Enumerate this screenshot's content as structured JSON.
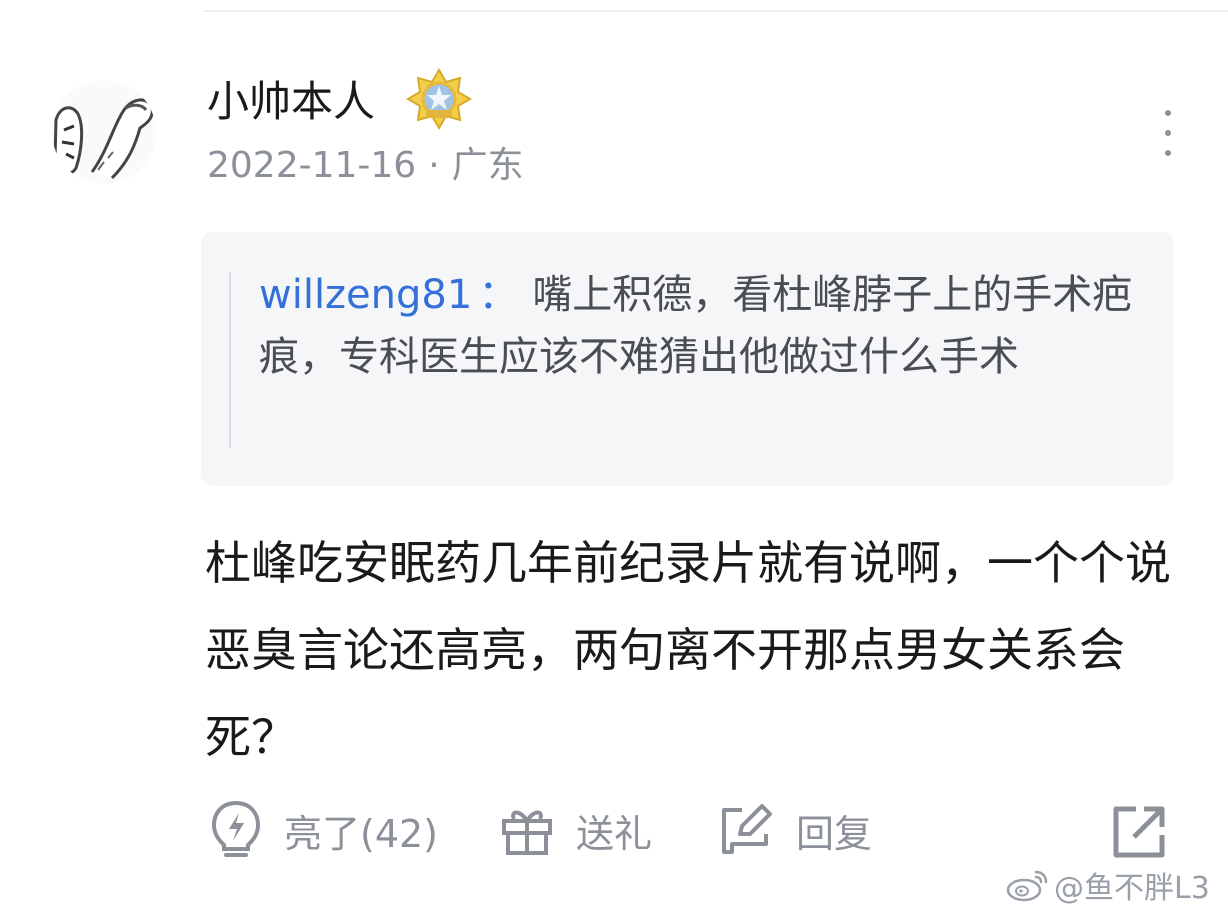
{
  "comment": {
    "username": "小帅本人",
    "date": "2022-11-16",
    "location": "广东",
    "meta_separator": "·",
    "quote": {
      "user": "willzeng81",
      "colon": "：",
      "text": "嘴上积德，看杜峰脖子上的手术疤痕，专科医生应该不难猜出他做过什么手术"
    },
    "body": "杜峰吃安眠药几年前纪录片就有说啊，一个个说恶臭言论还高亮，两句离不开那点男女关系会死？"
  },
  "actions": {
    "like_label": "亮了(42)",
    "gift_label": "送礼",
    "reply_label": "回复"
  },
  "watermark": {
    "text": "@鱼不胖L3"
  },
  "icons": {
    "avatar": "cartoon-avatar",
    "badge": "gold-medal-badge-icon",
    "more": "more-vertical-icon",
    "like": "lightbulb-icon",
    "gift": "gift-icon",
    "reply": "edit-reply-icon",
    "share": "share-external-icon",
    "watermark": "weibo-logo-icon"
  },
  "colors": {
    "text_primary": "#1a1a1a",
    "text_secondary": "#8c9099",
    "link_blue": "#3470d8",
    "quote_bg": "#f5f6f8"
  }
}
